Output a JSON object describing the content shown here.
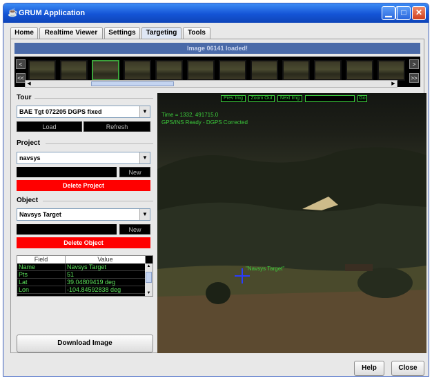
{
  "window": {
    "title": "GRUM Application"
  },
  "tabs": [
    {
      "label": "Home"
    },
    {
      "label": "Realtime Viewer"
    },
    {
      "label": "Settings"
    },
    {
      "label": "Targeting"
    },
    {
      "label": "Tools"
    }
  ],
  "active_tab": "Targeting",
  "status": {
    "message": "Image 06141 loaded!"
  },
  "filmstrip": {
    "prev_label": "<",
    "first_label": "<<",
    "next_label": ">",
    "last_label": ">>",
    "thumbnail_count": 12,
    "selected_index": 2
  },
  "tour": {
    "label": "Tour",
    "selected": "BAE Tgt 072205 DGPS fixed",
    "load_label": "Load",
    "refresh_label": "Refresh"
  },
  "project": {
    "label": "Project",
    "selected": "navsys",
    "new_label": "New",
    "delete_label": "Delete Project"
  },
  "object": {
    "label": "Object",
    "selected": "Navsys Target",
    "new_label": "New",
    "delete_label": "Delete Object"
  },
  "fields_table": {
    "headers": [
      "Field",
      "Value"
    ],
    "rows": [
      [
        "Name",
        "Navsys Target"
      ],
      [
        "Pts",
        "51"
      ],
      [
        "Lat",
        "39.04809419 deg"
      ],
      [
        "Lon",
        "-104.84592838 deg"
      ]
    ]
  },
  "download_label": "Download Image",
  "viewer": {
    "prev_img": "Prev Img",
    "zoom_out": "Zoom Out",
    "next_img": "Next Img",
    "go": "Go",
    "time_text": "Time = 1332, 491715.0",
    "gps_text": "GPS/INS Ready - DGPS Corrected",
    "target_label": "\"Navsys Target\""
  },
  "buttons": {
    "help": "Help",
    "close": "Close"
  },
  "colors": {
    "overlay_green": "#3ccc3c",
    "delete_red": "#ff0000",
    "status_bar": "#4a6aa8",
    "title_bar": "#1454d6"
  }
}
